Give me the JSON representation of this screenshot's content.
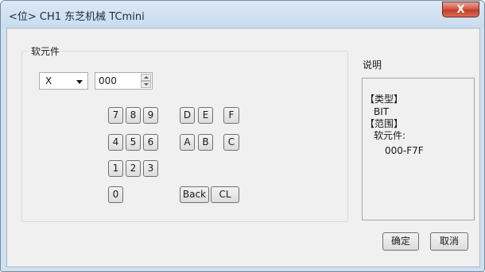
{
  "window": {
    "title": "<位> CH1 东芝机械 TCmini",
    "close_label": "X"
  },
  "device": {
    "group_label": "软元件",
    "type_select": {
      "value": "X"
    },
    "address_input": {
      "value": "000"
    }
  },
  "keypad": {
    "keys": [
      "7",
      "8",
      "9",
      "D",
      "E",
      "F",
      "4",
      "5",
      "6",
      "A",
      "B",
      "C",
      "1",
      "2",
      "3",
      "0",
      "Back",
      "CL"
    ]
  },
  "description": {
    "label": "说明",
    "lines": [
      "【类型】",
      "BIT",
      "【范围】",
      "软元件:",
      "000-F7F"
    ]
  },
  "buttons": {
    "ok_label": "确定",
    "cancel_label": "取消"
  },
  "icons": {
    "close": "close-icon",
    "dropdown": "chevron-down-icon",
    "spin_up": "spin-up-icon",
    "spin_down": "spin-down-icon"
  }
}
